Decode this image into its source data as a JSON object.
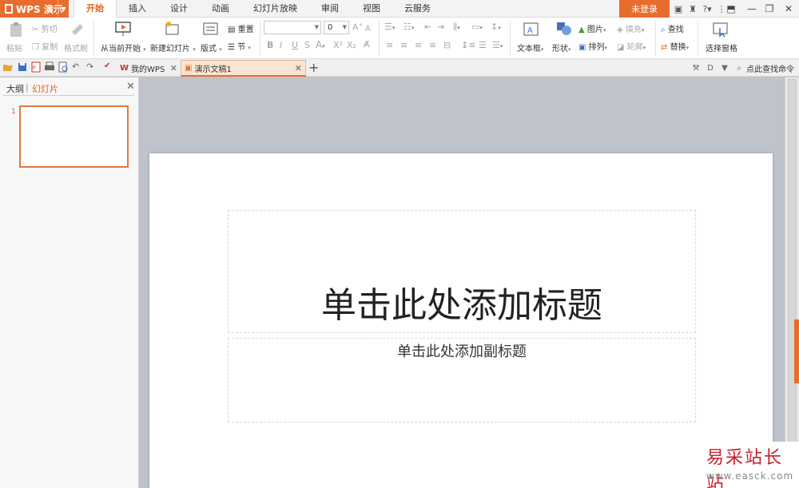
{
  "app": {
    "name": "WPS 演示"
  },
  "menu": {
    "tabs": [
      "开始",
      "插入",
      "设计",
      "动画",
      "幻灯片放映",
      "审阅",
      "视图",
      "云服务"
    ],
    "login_label": "未登录"
  },
  "ribbon": {
    "paste": "粘贴",
    "cut": "剪切",
    "copy": "复制",
    "format_painter": "格式刷",
    "from_current": "从当前开始",
    "new_slide": "新建幻灯片",
    "layout": "版式",
    "reset": "重置",
    "section": "节",
    "font_size": "0",
    "text_box": "文本框",
    "shape": "形状",
    "picture": "图片",
    "fill": "填充",
    "arrange": "排列",
    "outline": "轮廓",
    "find": "查找",
    "replace": "替换",
    "select_pane": "选择窗格"
  },
  "tabs": {
    "my_wps": "我的WPS",
    "document": "演示文稿1",
    "search_cmd": "点此查找命令"
  },
  "sidepanel": {
    "outline_tab": "大纲",
    "slides_tab": "幻灯片",
    "slide_number": "1"
  },
  "slide": {
    "title_placeholder": "单击此处添加标题",
    "subtitle_placeholder": "单击此处添加副标题"
  },
  "watermark": {
    "site_name": "易采站长站",
    "url": "www.easck.com"
  }
}
